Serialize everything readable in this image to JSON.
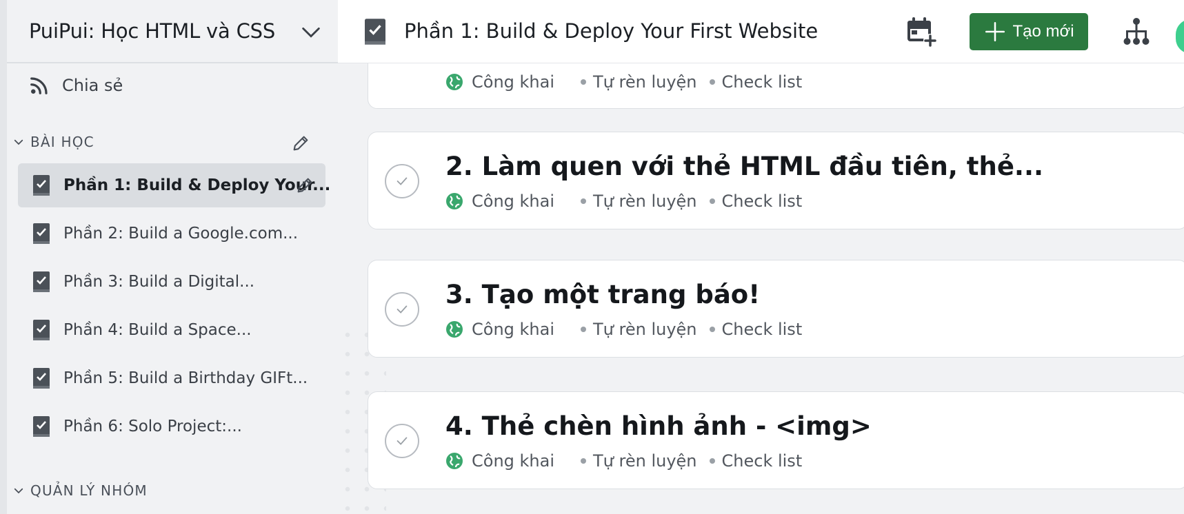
{
  "sidebar": {
    "workspace_title": "PuiPui: Học HTML và CSS",
    "share_label": "Chia sẻ",
    "sections": {
      "lessons_label": "BÀI HỌC",
      "group_label": "QUẢN LÝ NHÓM"
    },
    "items": [
      {
        "label": "Phần 1: Build & Deploy Your...",
        "active": true
      },
      {
        "label": "Phần 2: Build a Google.com..."
      },
      {
        "label": "Phần 3: Build a Digital..."
      },
      {
        "label": "Phần 4: Build a Space..."
      },
      {
        "label": "Phần 5: Build a Birthday GIFt..."
      },
      {
        "label": "Phần 6: Solo Project:..."
      }
    ]
  },
  "header": {
    "title": "Phần 1: Build & Deploy Your First Website",
    "create_label": "Tạo mới"
  },
  "cards": [
    {
      "title": "",
      "visibility": "Công khai",
      "type": "Tự rèn luyện",
      "format": "Check list"
    },
    {
      "title": "2. Làm quen với thẻ HTML đầu tiên, thẻ...",
      "visibility": "Công khai",
      "type": "Tự rèn luyện",
      "format": "Check list"
    },
    {
      "title": "3. Tạo một trang báo!",
      "visibility": "Công khai",
      "type": "Tự rèn luyện",
      "format": "Check list"
    },
    {
      "title": "4. Thẻ chèn hình ảnh - <img>",
      "visibility": "Công khai",
      "type": "Tự rèn luyện",
      "format": "Check list"
    }
  ],
  "icons": {
    "workspace_chevron": "chevron-down-icon",
    "share": "rss-icon",
    "lesson": "checkbox-doc-icon",
    "edit": "pencil-icon",
    "calendar": "calendar-add-icon",
    "create": "plus-icon",
    "tree": "sitemap-icon",
    "visibility": "globe-icon",
    "check": "check-icon"
  },
  "colors": {
    "primary_button": "#2b7a3f",
    "globe": "#3aa76d",
    "active_item_bg": "#dadde1"
  }
}
